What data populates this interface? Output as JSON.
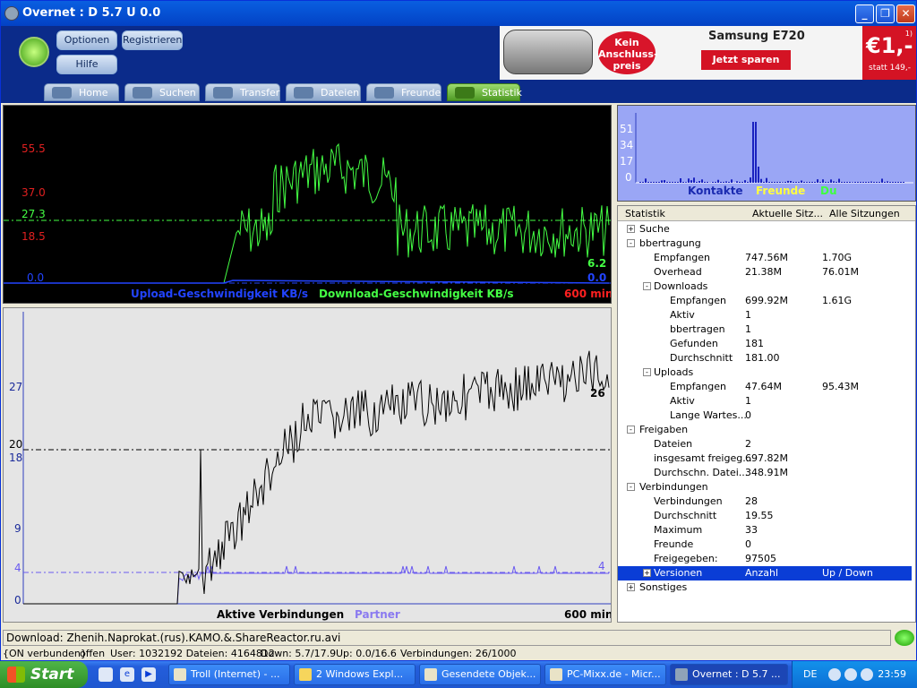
{
  "window": {
    "title": "Overnet : D 5.7 U 0.0"
  },
  "header": {
    "buttons": {
      "optionen": "Optionen",
      "registrieren": "Registrieren",
      "hilfe": "Hilfe"
    },
    "tabs": [
      "Home",
      "Suchen",
      "Transfer",
      "Dateien",
      "Freunde",
      "Statistik"
    ],
    "active_tab": "Statistik"
  },
  "ad": {
    "badge": "Kein Anschluss- preis",
    "model": "Samsung E720",
    "cta": "Jetzt sparen",
    "price": "€1,-",
    "footnote_mark": "1)",
    "statt": "statt 149,-"
  },
  "speed_chart": {
    "y_ticks": [
      "55.5",
      "37.0",
      "27.3",
      "18.5",
      "0.0"
    ],
    "legend_upload": "Upload-Geschwindigkeit KB/s",
    "legend_download": "Download-Geschwindigkeit KB/s",
    "time_span": "600 min",
    "current_download": "6.2",
    "current_upload": "0.0"
  },
  "conn_chart": {
    "y_ticks": [
      "27",
      "20",
      "18",
      "9",
      "4",
      "0"
    ],
    "legend_active": "Aktive Verbindungen",
    "legend_partner": "Partner",
    "time_span": "600 min",
    "current_active": "26",
    "current_partner": "4"
  },
  "net_chart": {
    "y_ticks": [
      "51",
      "34",
      "17",
      "0"
    ],
    "legend": [
      "Kontakte",
      "Freunde",
      "Du"
    ]
  },
  "stats": {
    "columns": [
      "Statistik",
      "Aktuelle Sitz...",
      "Alle Sitzungen"
    ],
    "rows": [
      {
        "label": "Suche",
        "cur": "",
        "all": "",
        "level": 0,
        "exp": "+"
      },
      {
        "label": "bbertragung",
        "cur": "",
        "all": "",
        "level": 0,
        "exp": "-"
      },
      {
        "label": "Empfangen",
        "cur": "747.56M",
        "all": "1.70G",
        "level": 1,
        "exp": ""
      },
      {
        "label": "Overhead",
        "cur": "21.38M",
        "all": "76.01M",
        "level": 1,
        "exp": ""
      },
      {
        "label": "Downloads",
        "cur": "",
        "all": "",
        "level": 1,
        "exp": "-"
      },
      {
        "label": "Empfangen",
        "cur": "699.92M",
        "all": "1.61G",
        "level": 2,
        "exp": ""
      },
      {
        "label": "Aktiv",
        "cur": "1",
        "all": "",
        "level": 2,
        "exp": ""
      },
      {
        "label": "bbertragen",
        "cur": "1",
        "all": "",
        "level": 2,
        "exp": ""
      },
      {
        "label": "Gefunden",
        "cur": "181",
        "all": "",
        "level": 2,
        "exp": ""
      },
      {
        "label": "Durchschnitt",
        "cur": "181.00",
        "all": "",
        "level": 2,
        "exp": ""
      },
      {
        "label": "Uploads",
        "cur": "",
        "all": "",
        "level": 1,
        "exp": "-"
      },
      {
        "label": "Empfangen",
        "cur": "47.64M",
        "all": "95.43M",
        "level": 2,
        "exp": ""
      },
      {
        "label": "Aktiv",
        "cur": "1",
        "all": "",
        "level": 2,
        "exp": ""
      },
      {
        "label": "Lange Wartes...",
        "cur": "0",
        "all": "",
        "level": 2,
        "exp": ""
      },
      {
        "label": "Freigaben",
        "cur": "",
        "all": "",
        "level": 0,
        "exp": "-"
      },
      {
        "label": "Dateien",
        "cur": "2",
        "all": "",
        "level": 1,
        "exp": ""
      },
      {
        "label": "insgesamt freigeg...",
        "cur": "697.82M",
        "all": "",
        "level": 1,
        "exp": ""
      },
      {
        "label": "Durchschn. Datei...",
        "cur": "348.91M",
        "all": "",
        "level": 1,
        "exp": ""
      },
      {
        "label": "Verbindungen",
        "cur": "",
        "all": "",
        "level": 0,
        "exp": "-"
      },
      {
        "label": "Verbindungen",
        "cur": "28",
        "all": "",
        "level": 1,
        "exp": ""
      },
      {
        "label": "Durchschnitt",
        "cur": "19.55",
        "all": "",
        "level": 1,
        "exp": ""
      },
      {
        "label": "Maximum",
        "cur": "33",
        "all": "",
        "level": 1,
        "exp": ""
      },
      {
        "label": "Freunde",
        "cur": "0",
        "all": "",
        "level": 1,
        "exp": ""
      },
      {
        "label": "Freigegeben:",
        "cur": "97505",
        "all": "",
        "level": 1,
        "exp": ""
      },
      {
        "label": "Versionen",
        "cur": "Anzahl",
        "all": "Up / Down",
        "level": 1,
        "exp": "+",
        "selected": true
      },
      {
        "label": "Sonstiges",
        "cur": "",
        "all": "",
        "level": 0,
        "exp": "+"
      }
    ]
  },
  "statusbar": {
    "download": "Download: Zhenih.Naprokat.(rus).KAMO.&.ShareReactor.ru.avi",
    "connected": "{ON verbunden}",
    "open": "offen",
    "users": "User: 1032192 Dateien: 4164812",
    "down": "Down: 5.7/17.9",
    "up": "Up: 0.0/16.6",
    "connections": "Verbindungen: 26/1000"
  },
  "taskbar": {
    "start": "Start",
    "tasks": [
      "Troll (Internet) - ...",
      "2 Windows Expl...",
      "Gesendete Objek...",
      "PC-Mixx.de - Micr...",
      "Overnet : D 5.7 ..."
    ],
    "lang": "DE",
    "clock": "23:59"
  },
  "colors": {
    "accent_green": "#44ff44",
    "upload_blue": "#2244ff",
    "title_blue": "#0653d6",
    "selection": "#0a3dd6"
  }
}
